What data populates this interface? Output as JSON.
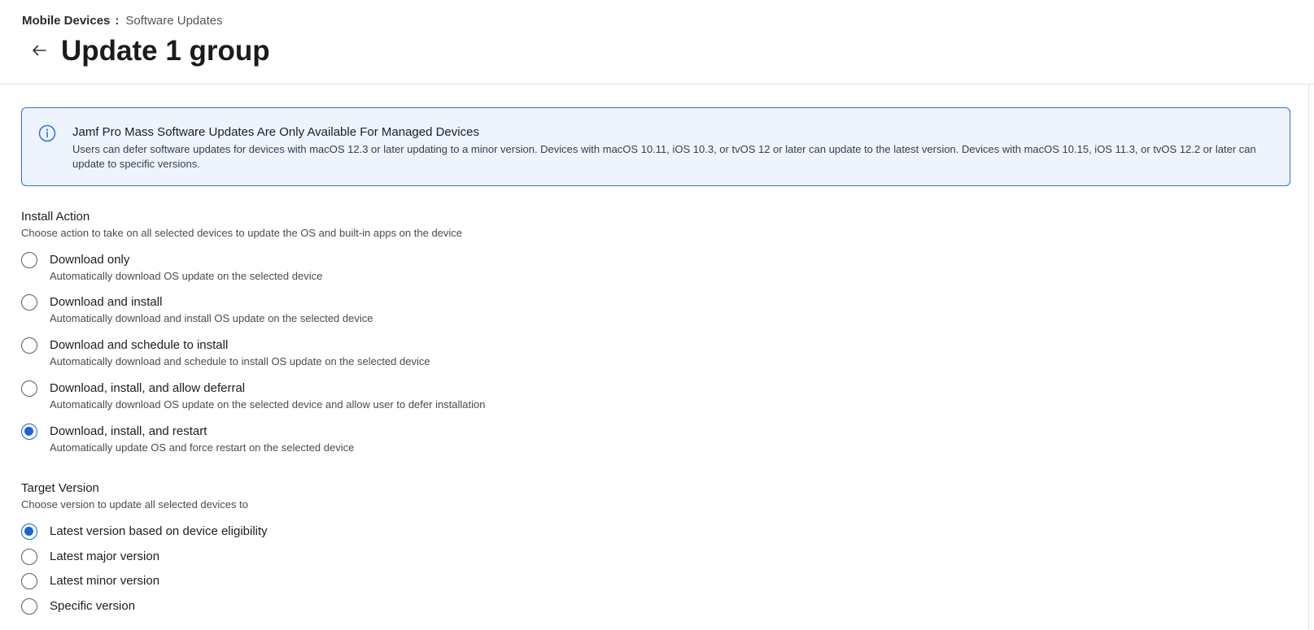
{
  "breadcrumb": {
    "parent": "Mobile Devices",
    "separator": ":",
    "current": "Software Updates"
  },
  "header": {
    "back_icon": "arrow-left-icon",
    "title": "Update 1 group"
  },
  "info": {
    "icon": "info-icon",
    "title": "Jamf Pro Mass Software Updates Are Only Available For Managed Devices",
    "body": "Users can defer software updates for devices with macOS 12.3 or later updating to a minor version. Devices with macOS 10.11, iOS 10.3, or tvOS 12 or later can update to the latest version. Devices with macOS 10.15, iOS 11.3, or tvOS 12.2 or later can update to specific versions."
  },
  "install_action": {
    "title": "Install Action",
    "subtitle": "Choose action to take on all selected devices to update the OS and built-in apps on the device",
    "selected_index": 4,
    "options": [
      {
        "label": "Download only",
        "desc": "Automatically download OS update on the selected device"
      },
      {
        "label": "Download and install",
        "desc": "Automatically download and install OS update on the selected device"
      },
      {
        "label": "Download and schedule to install",
        "desc": "Automatically download and schedule to install OS update on the selected device"
      },
      {
        "label": "Download, install, and allow deferral",
        "desc": "Automatically download OS update on the selected device and allow user to defer installation"
      },
      {
        "label": "Download, install, and restart",
        "desc": "Automatically update OS and force restart on the selected device"
      }
    ]
  },
  "target_version": {
    "title": "Target Version",
    "subtitle": "Choose version to update all selected devices to",
    "selected_index": 0,
    "options": [
      {
        "label": "Latest version based on device eligibility"
      },
      {
        "label": "Latest major version"
      },
      {
        "label": "Latest minor version"
      },
      {
        "label": "Specific version"
      }
    ]
  },
  "colors": {
    "accent": "#1a63d6",
    "info_border": "#2f6fd6",
    "info_background": "#eef4fd"
  }
}
